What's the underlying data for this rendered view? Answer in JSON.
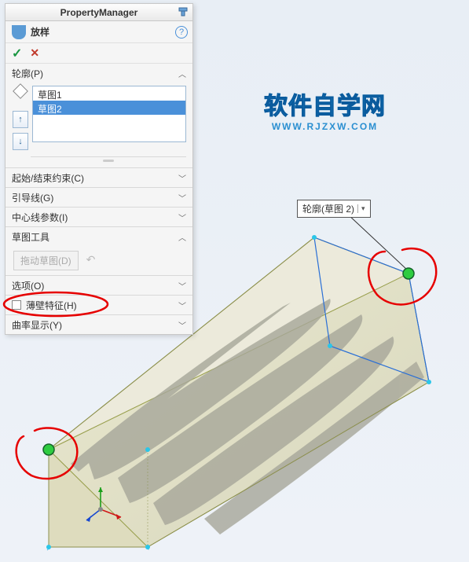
{
  "panel": {
    "title": "PropertyManager",
    "feature_name": "放样",
    "help": "?",
    "ok": "✓",
    "cancel": "✕"
  },
  "sections": {
    "profiles": {
      "label": "轮廓(P)"
    },
    "start_end": {
      "label": "起始/结束约束(C)"
    },
    "guides": {
      "label": "引导线(G)"
    },
    "centerline": {
      "label": "中心线参数(I)"
    },
    "sketch_tools": {
      "label": "草图工具",
      "drag_btn": "拖动草图(D)"
    },
    "options": {
      "label": "选项(O)"
    },
    "thin": {
      "label": "薄壁特征(H)"
    },
    "curvature": {
      "label": "曲率显示(Y)"
    }
  },
  "profiles_list": [
    "草图1",
    "草图2"
  ],
  "callout": {
    "text": "轮廓(草图 2)"
  },
  "watermark": {
    "cn": "软件自学网",
    "en": "WWW.RJZXW.COM"
  }
}
